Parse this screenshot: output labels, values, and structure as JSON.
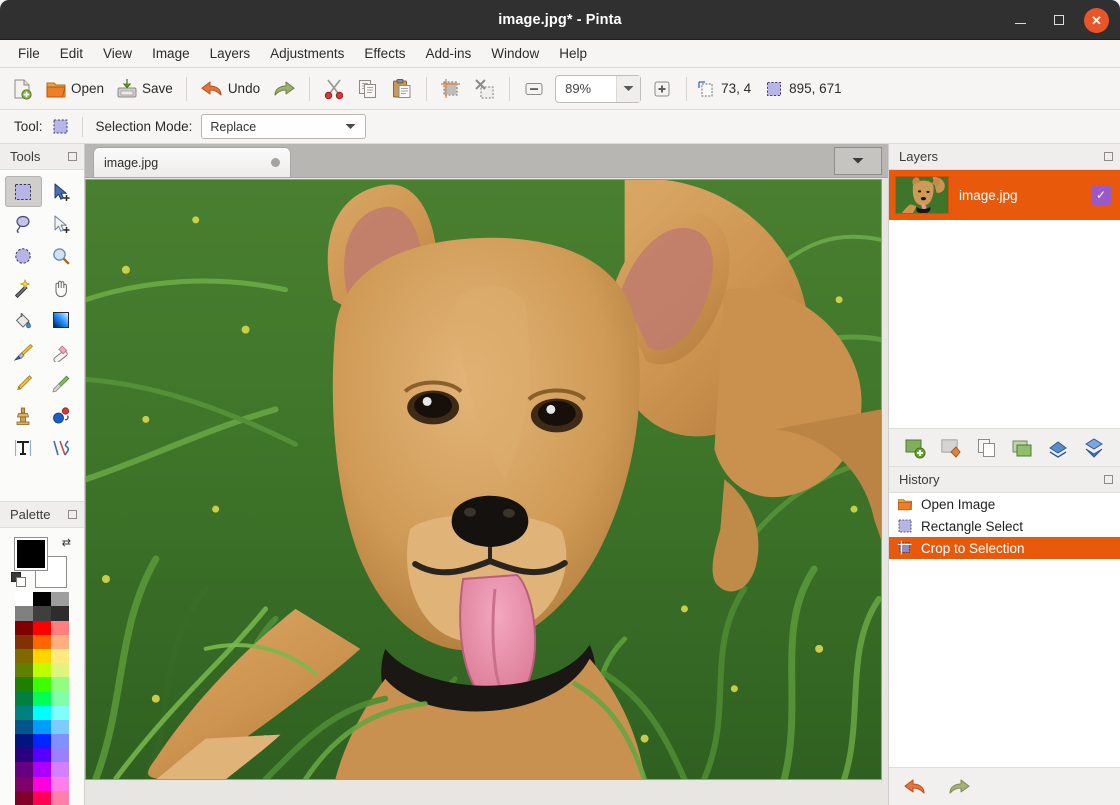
{
  "window": {
    "title": "image.jpg* - Pinta",
    "controls": {
      "minimize": "minimize-button",
      "maximize": "maximize-button",
      "close": "✕"
    }
  },
  "menubar": {
    "items": [
      {
        "label": "File"
      },
      {
        "label": "Edit"
      },
      {
        "label": "View"
      },
      {
        "label": "Image"
      },
      {
        "label": "Layers"
      },
      {
        "label": "Adjustments"
      },
      {
        "label": "Effects"
      },
      {
        "label": "Add-ins"
      },
      {
        "label": "Window"
      },
      {
        "label": "Help"
      }
    ]
  },
  "toolbar": {
    "new_label": "",
    "open_label": "Open",
    "save_label": "Save",
    "undo_label": "Undo",
    "redo_label": "",
    "zoom_value": "89%",
    "cursor_position": "73, 4",
    "selection_size": "895, 671"
  },
  "tool_options": {
    "tool_label": "Tool:",
    "selection_mode_label": "Selection Mode:",
    "selection_mode_value": "Replace"
  },
  "tools_dock": {
    "title": "Tools",
    "tools": [
      {
        "name": "rectangle-select-tool",
        "active": true
      },
      {
        "name": "move-selected-tool",
        "active": false
      },
      {
        "name": "lasso-select-tool",
        "active": false
      },
      {
        "name": "move-selection-tool",
        "active": false
      },
      {
        "name": "ellipse-select-tool",
        "active": false
      },
      {
        "name": "zoom-tool",
        "active": false
      },
      {
        "name": "magic-wand-tool",
        "active": false
      },
      {
        "name": "pan-tool",
        "active": false
      },
      {
        "name": "paint-bucket-tool",
        "active": false
      },
      {
        "name": "gradient-tool",
        "active": false
      },
      {
        "name": "paintbrush-tool",
        "active": false
      },
      {
        "name": "eraser-tool",
        "active": false
      },
      {
        "name": "pencil-tool",
        "active": false
      },
      {
        "name": "color-picker-tool",
        "active": false
      },
      {
        "name": "clone-stamp-tool",
        "active": false
      },
      {
        "name": "recolor-tool",
        "active": false
      },
      {
        "name": "text-tool",
        "active": false
      },
      {
        "name": "line-curve-tool",
        "active": false
      }
    ]
  },
  "palette_dock": {
    "title": "Palette",
    "primary_color": "#000000",
    "secondary_color": "#ffffff",
    "swatches": [
      "#ffffff",
      "#000000",
      "#9e9e9e",
      "#808080",
      "#3f3f3f",
      "#2d2d2d",
      "#800000",
      "#ff0000",
      "#ff7f7f",
      "#803300",
      "#ff6600",
      "#ffaf7f",
      "#806a00",
      "#ffd500",
      "#ffea7f",
      "#5f8000",
      "#beff00",
      "#def47f",
      "#1f8000",
      "#3cff00",
      "#90ff7f",
      "#00803f",
      "#00ff55",
      "#7fffa8",
      "#007f7f",
      "#00ffff",
      "#7fffff",
      "#00558a",
      "#009cff",
      "#7fcaff",
      "#001580",
      "#0026ff",
      "#8090ff",
      "#2a0080",
      "#5500ff",
      "#9b7fff",
      "#660080",
      "#aa00ff",
      "#d47fff",
      "#80006a",
      "#ff00dd",
      "#ff7fe8",
      "#800029",
      "#ff0055",
      "#ff7fa8"
    ]
  },
  "document": {
    "tab_label": "image.jpg",
    "tab_close": "close-tab-dot"
  },
  "layers_panel": {
    "title": "Layers",
    "layers": [
      {
        "name": "image.jpg",
        "visible": true,
        "selected": true,
        "check_glyph": "✓"
      }
    ],
    "actions": [
      {
        "name": "add-layer-button"
      },
      {
        "name": "delete-layer-button"
      },
      {
        "name": "duplicate-layer-button"
      },
      {
        "name": "merge-layer-down-button"
      },
      {
        "name": "move-layer-up-button"
      },
      {
        "name": "move-layer-down-button"
      }
    ]
  },
  "history_panel": {
    "title": "History",
    "entries": [
      {
        "label": "Open Image",
        "icon": "open-image-icon",
        "selected": false
      },
      {
        "label": "Rectangle Select",
        "icon": "rectangle-select-icon",
        "selected": false
      },
      {
        "label": "Crop to Selection",
        "icon": "crop-to-selection-icon",
        "selected": true
      }
    ],
    "undo_label": "undo-button",
    "redo_label": "redo-button"
  },
  "colors": {
    "accent": "#e8590c",
    "titlebar_bg": "#303030",
    "chrome_bg": "#f6f5f4",
    "close_button": "#e9552a",
    "layer_check": "#9b59c7"
  }
}
